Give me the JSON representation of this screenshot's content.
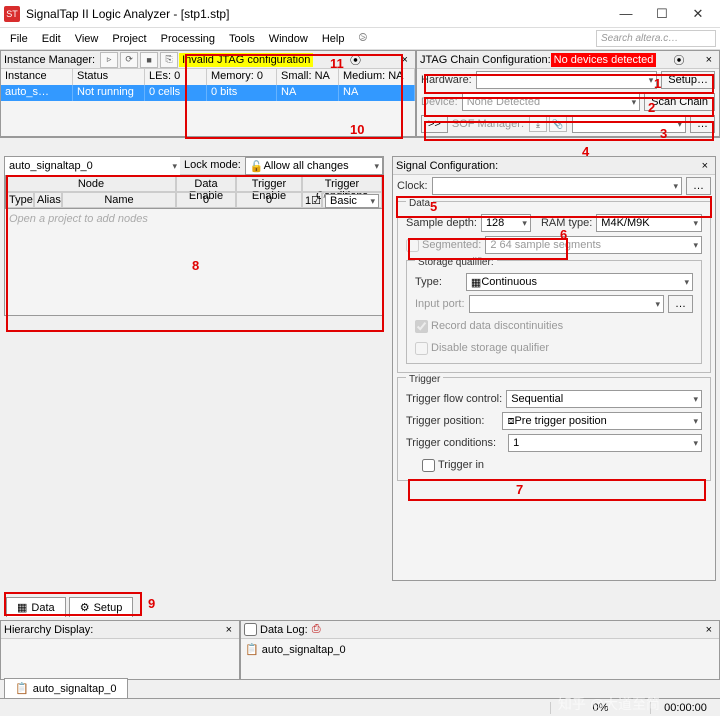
{
  "window": {
    "title": "SignalTap II Logic Analyzer - [stp1.stp]"
  },
  "menu": [
    "File",
    "Edit",
    "View",
    "Project",
    "Processing",
    "Tools",
    "Window",
    "Help"
  ],
  "search_placeholder": "Search altera.c…",
  "instance_mgr": {
    "label": "Instance Manager:",
    "status": "Invalid JTAG configuration",
    "cols": {
      "instance": "Instance",
      "status": "Status",
      "les": "LEs: 0",
      "memory": "Memory: 0",
      "small": "Small: NA",
      "medium": "Medium: NA"
    },
    "row": {
      "name": "auto_s…",
      "status": "Not running",
      "les": "0 cells",
      "memory": "0 bits",
      "small": "NA",
      "medium": "NA"
    }
  },
  "jtag": {
    "label": "JTAG Chain Configuration:",
    "status": "No devices detected",
    "hardware_lbl": "Hardware:",
    "setup_btn": "Setup…",
    "device_lbl": "Device:",
    "device_val": "None Detected",
    "scan_btn": "Scan Chain",
    "sof_lbl": "SOF Manager:",
    "sof_btn": "…",
    "arrow": ">>"
  },
  "node_panel": {
    "title": "auto_signaltap_0",
    "lockmode_lbl": "Lock mode:",
    "lockmode_val": "Allow all changes",
    "headers": {
      "node": "Node",
      "data_enable": "Data Enable",
      "trigger_enable": "Trigger Enable",
      "trigger_conditions": "Trigger Conditions",
      "type": "Type",
      "alias": "Alias",
      "name": "Name",
      "basic": "Basic"
    },
    "vals": {
      "data_enable": "0",
      "trigger_enable": "0",
      "tc": "1"
    },
    "placeholder": "Open a project to add nodes"
  },
  "signal_cfg": {
    "title": "Signal Configuration:",
    "clock_lbl": "Clock:",
    "clock_btn": "…",
    "data_legend": "Data",
    "sample_depth_lbl": "Sample depth:",
    "sample_depth_val": "128",
    "ram_type_lbl": "RAM type:",
    "ram_type_val": "M4K/M9K",
    "segmented_lbl": "Segmented:",
    "segmented_val": "2  64 sample segments",
    "storage_legend": "Storage qualifier:",
    "type_lbl": "Type:",
    "type_val": "Continuous",
    "input_port_lbl": "Input port:",
    "input_port_btn": "…",
    "record_lbl": "Record data discontinuities",
    "disable_lbl": "Disable storage qualifier",
    "trigger_legend": "Trigger",
    "flow_lbl": "Trigger flow control:",
    "flow_val": "Sequential",
    "pos_lbl": "Trigger position:",
    "pos_val": "Pre trigger position",
    "cond_lbl": "Trigger conditions:",
    "cond_val": "1",
    "trigger_in_lbl": "Trigger in"
  },
  "tabs": {
    "data": "Data",
    "setup": "Setup"
  },
  "hierarchy": {
    "title": "Hierarchy Display:"
  },
  "datalog": {
    "title": "Data Log:",
    "item": "auto_signaltap_0"
  },
  "bottom_tab": "auto_signaltap_0",
  "status": {
    "pct": "0%",
    "time": "00:00:00"
  },
  "annotations": {
    "n1": "1",
    "n2": "2",
    "n3": "3",
    "n4": "4",
    "n5": "5",
    "n6": "6",
    "n7": "7",
    "n8": "8",
    "n9": "9",
    "n10": "10",
    "n11": "11"
  },
  "watermark": "知乎 @大道至简"
}
